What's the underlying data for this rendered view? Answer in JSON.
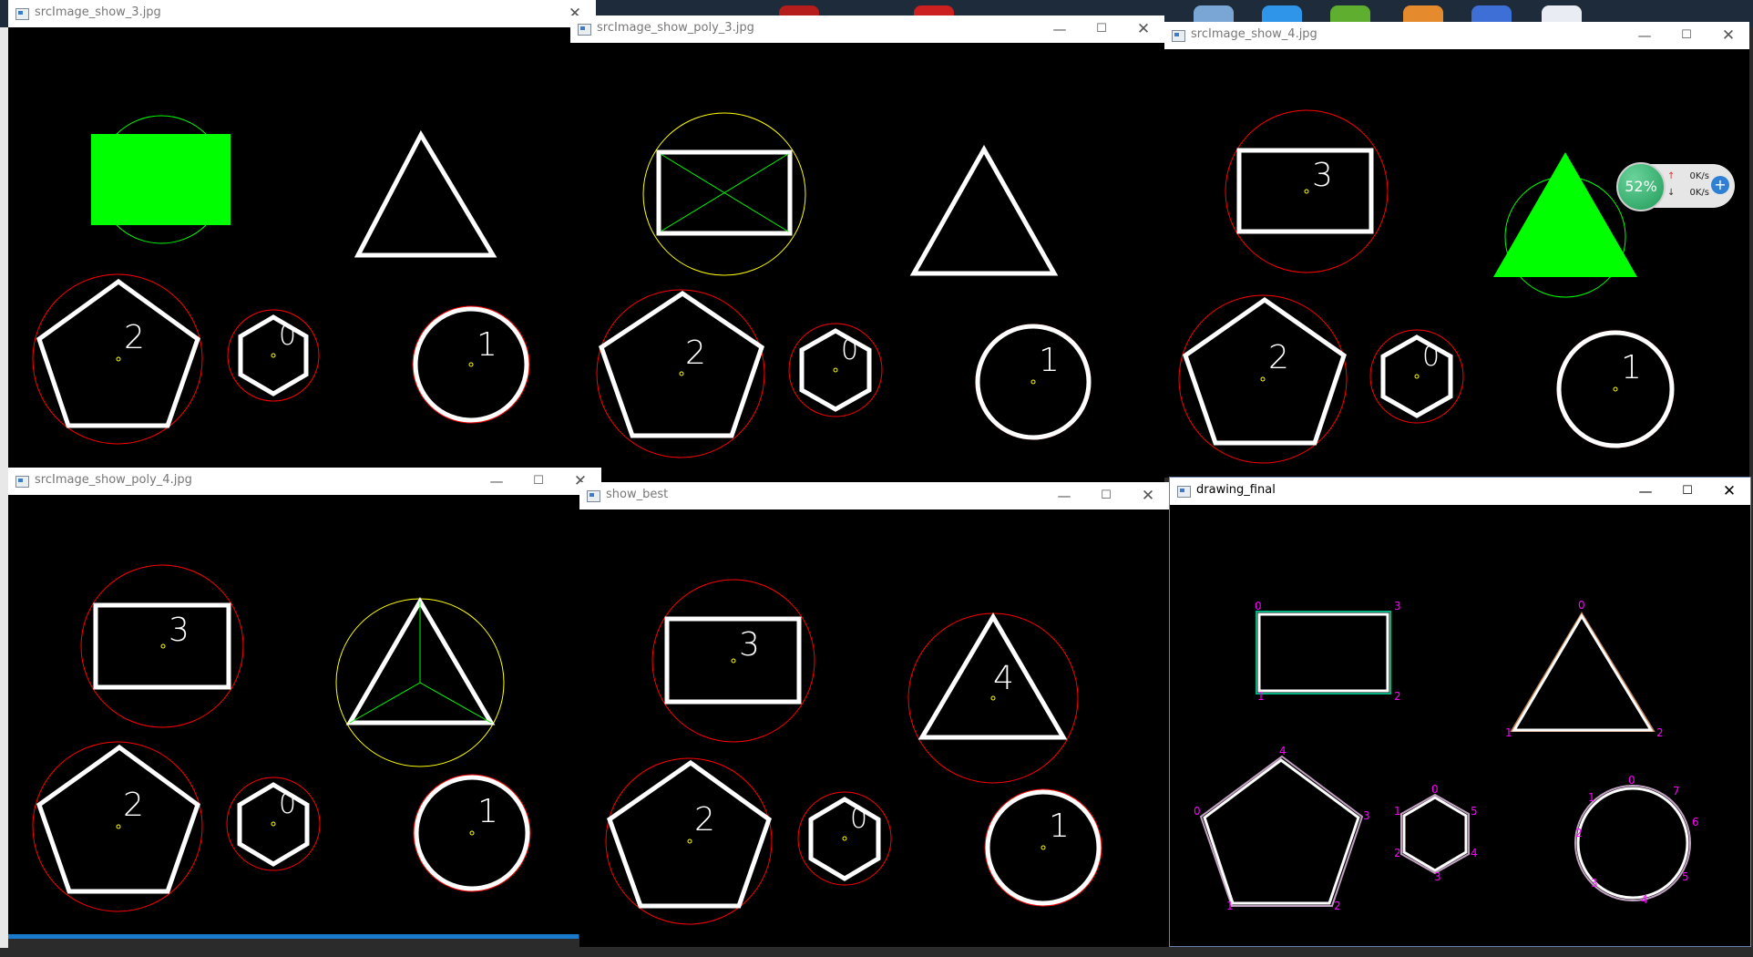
{
  "windows": {
    "w1": {
      "title": "srcImage_show_3.jpg",
      "labels": [
        "2",
        "0",
        "1"
      ]
    },
    "w2": {
      "title": "srcImage_show_poly_3.jpg",
      "labels": [
        "2",
        "0",
        "1"
      ]
    },
    "w3": {
      "title": "srcImage_show_4.jpg",
      "labels": [
        "3",
        "2",
        "0",
        "1"
      ]
    },
    "w4": {
      "title": "srcImage_show_poly_4.jpg",
      "labels": [
        "3",
        "2",
        "0",
        "1"
      ]
    },
    "w5": {
      "title": "show_best",
      "labels": [
        "3",
        "4",
        "2",
        "0",
        "1"
      ]
    },
    "w6": {
      "title": "drawing_final",
      "rect_vertices": [
        "0",
        "3",
        "1",
        "2"
      ],
      "triangle_vertices": [
        "0",
        "1",
        "2"
      ],
      "pentagon_vertices": [
        "4",
        "0",
        "3",
        "1",
        "2"
      ],
      "hexagon_vertices": [
        "0",
        "1",
        "5",
        "2",
        "4",
        "3"
      ],
      "circle_vertices": [
        "0",
        "1",
        "7",
        "2",
        "6",
        "3",
        "5",
        "4"
      ]
    }
  },
  "controls": {
    "minimize": "—",
    "maximize": "☐",
    "close": "✕"
  },
  "network_widget": {
    "percent": "52%",
    "upload": "0K/s",
    "download": "0K/s",
    "add": "+"
  },
  "colors": {
    "shape_stroke": "#ffffff",
    "min_circle": "#ff0000",
    "enclosing_yellow": "#ffff00",
    "contour_green": "#00ff00",
    "fill_green": "#00ff00",
    "vertex_label": "#ff00ff",
    "taskbar_accent": "#1979ca"
  }
}
